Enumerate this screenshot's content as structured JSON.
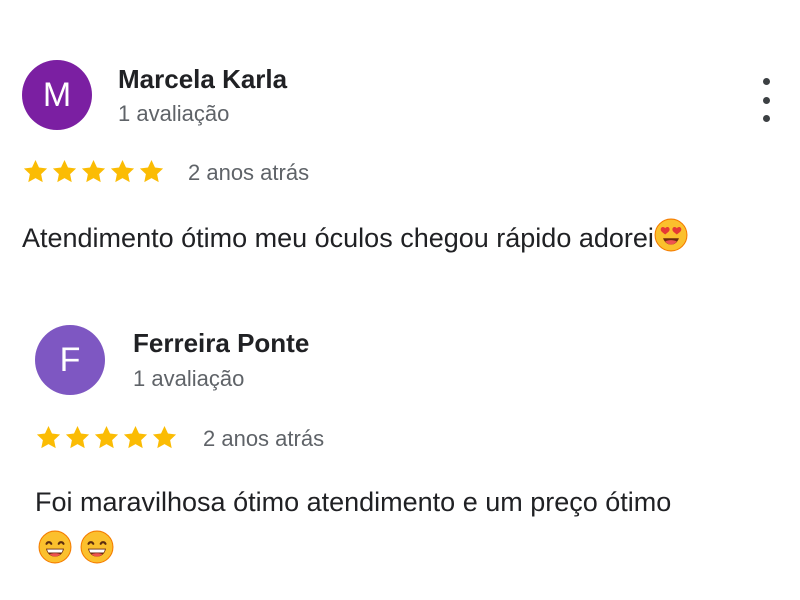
{
  "reviews": [
    {
      "avatar_letter": "M",
      "avatar_color": "#7b1fa2",
      "name": "Marcela Karla",
      "review_count": "1 avaliação",
      "rating": 5,
      "max_rating": 5,
      "date": "2 anos atrás",
      "text": "Atendimento ótimo meu óculos chegou rápido adorei",
      "emojis": [
        "smiling-face-with-heart-eyes-emoji"
      ]
    },
    {
      "avatar_letter": "F",
      "avatar_color": "#7e57c2",
      "name": "Ferreira Ponte",
      "review_count": "1 avaliação",
      "rating": 5,
      "max_rating": 5,
      "date": "2 anos atrás",
      "text_line1": "Foi maravilhosa ótimo atendimento e um preço ótimo",
      "emojis": [
        "grinning-face-with-smiling-eyes-emoji",
        "grinning-face-with-smiling-eyes-emoji"
      ]
    }
  ],
  "colors": {
    "star": "#fbbc04",
    "name": "#202124",
    "secondary": "#5f6368"
  },
  "icons": {
    "menu": "more-vertical-icon",
    "star": "star-icon"
  }
}
